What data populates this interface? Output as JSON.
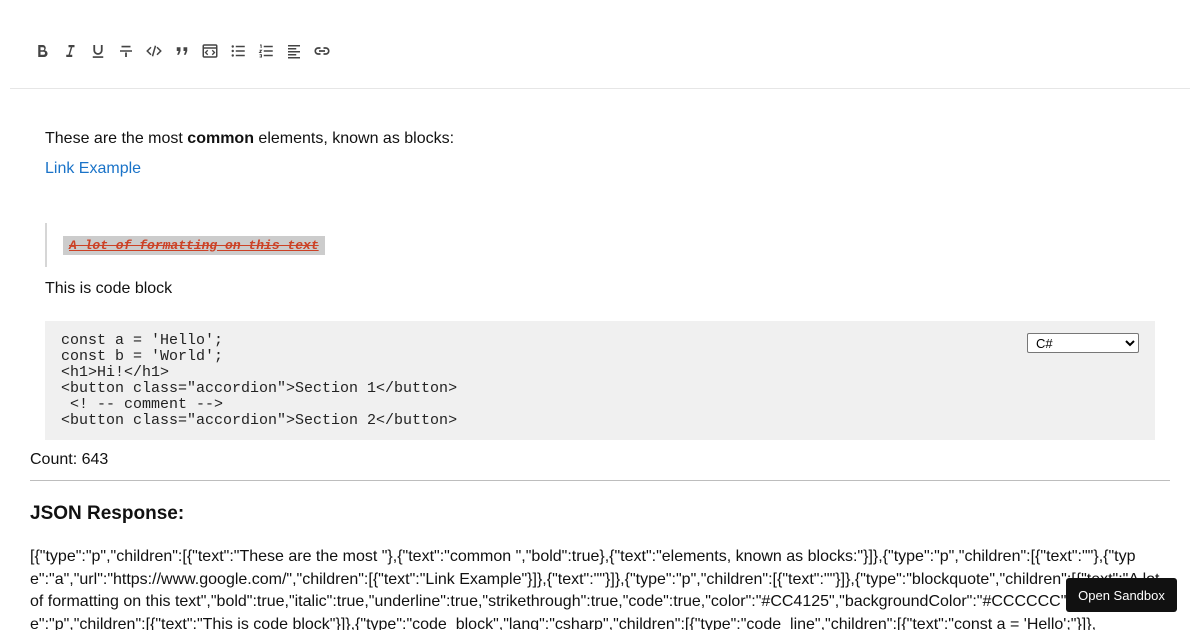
{
  "toolbar": {
    "buttons": [
      {
        "name": "bold-icon"
      },
      {
        "name": "italic-icon"
      },
      {
        "name": "underline-icon"
      },
      {
        "name": "strikethrough-icon"
      },
      {
        "name": "code-icon"
      },
      {
        "name": "quote-icon"
      },
      {
        "name": "code-block-icon"
      },
      {
        "name": "bulleted-list-icon"
      },
      {
        "name": "numbered-list-icon"
      },
      {
        "name": "align-left-icon"
      },
      {
        "name": "link-icon"
      }
    ]
  },
  "editor": {
    "para1_before": "These are the most ",
    "para1_bold": "common",
    "para1_after": " elements, known as blocks:",
    "link_text": "Link Example",
    "quote_text": "A lot of formatting on this text",
    "quote_color": "#CC4125",
    "quote_bg": "#CCCCCC",
    "para3": "This is code block",
    "code_lines": [
      "const a = 'Hello';",
      "const b = 'World';",
      "",
      "<h1>Hi!</h1>",
      "<button class=\"accordion\">Section 1</button>",
      " <! -- comment -->",
      "<button class=\"accordion\">Section 2</button>"
    ],
    "code_lang": "C#"
  },
  "count_label": "Count: 643",
  "json_title": "JSON Response:",
  "json_text": "[{\"type\":\"p\",\"children\":[{\"text\":\"These are the most \"},{\"text\":\"common \",\"bold\":true},{\"text\":\"elements, known as blocks:\"}]},{\"type\":\"p\",\"children\":[{\"text\":\"\"},{\"type\":\"a\",\"url\":\"https://www.google.com/\",\"children\":[{\"text\":\"Link Example\"}]},{\"text\":\"\"}]},{\"type\":\"p\",\"children\":[{\"text\":\"\"}]},{\"type\":\"blockquote\",\"children\":[{\"text\":\"A lot of formatting on this text\",\"bold\":true,\"italic\":true,\"underline\":true,\"strikethrough\":true,\"code\":true,\"color\":\"#CC4125\",\"backgroundColor\":\"#CCCCCC\"}]},{\"type\":\"p\",\"children\":[{\"text\":\"This is code block\"}]},{\"type\":\"code_block\",\"lang\":\"csharp\",\"children\":[{\"type\":\"code_line\",\"children\":[{\"text\":\"const a = 'Hello';\"}]},",
  "sandbox_label": "Open Sandbox"
}
